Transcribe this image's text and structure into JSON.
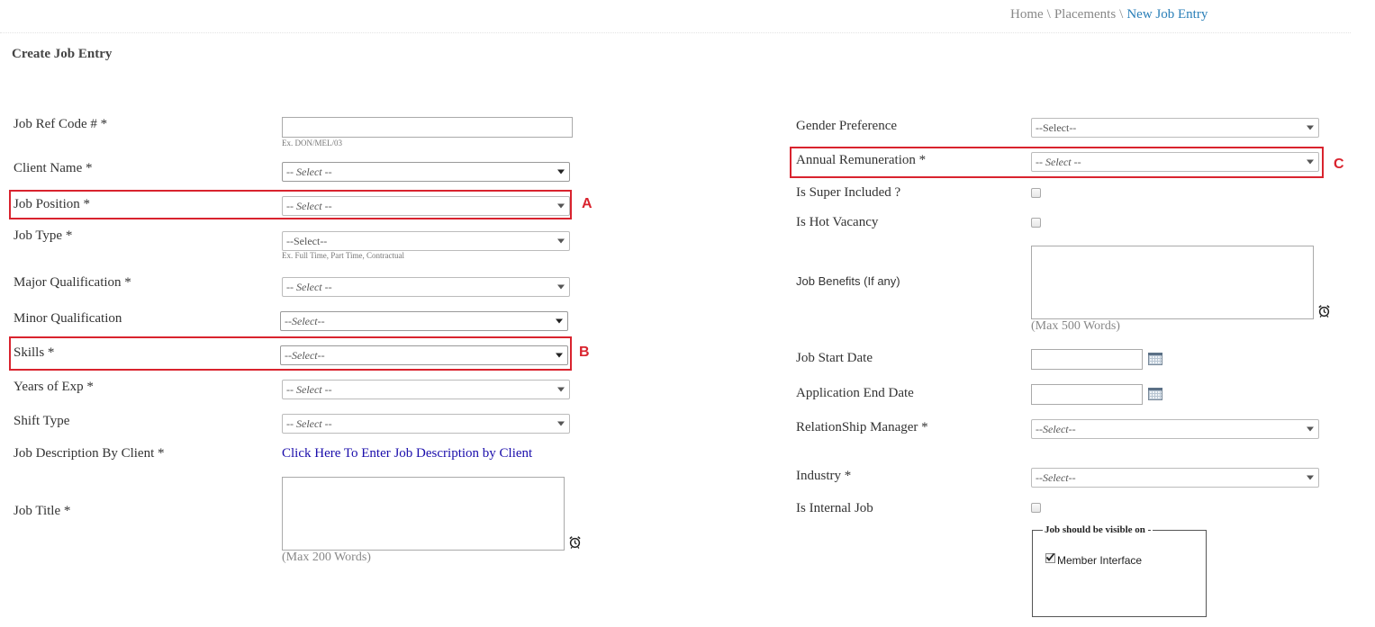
{
  "breadcrumb": {
    "home": "Home",
    "placements": "Placements",
    "current": "New Job Entry",
    "separator": "\\"
  },
  "page_title": "Create Job Entry",
  "left": {
    "job_ref_code": {
      "label": "Job Ref Code # *",
      "value": "",
      "hint": "Ex. DON/MEL/03"
    },
    "client_name": {
      "label": "Client Name *",
      "selected": "-- Select --"
    },
    "job_position": {
      "label": "Job Position *",
      "selected": "-- Select --",
      "marker": "A"
    },
    "job_type": {
      "label": "Job Type *",
      "selected": "--Select--",
      "hint": "Ex. Full Time, Part Time, Contractual"
    },
    "major_qualification": {
      "label": "Major Qualification *",
      "selected": "-- Select --"
    },
    "minor_qualification": {
      "label": "Minor Qualification",
      "selected": "--Select--"
    },
    "skills": {
      "label": "Skills *",
      "selected": "--Select--",
      "marker": "B"
    },
    "years_of_exp": {
      "label": "Years of Exp *",
      "selected": "-- Select --"
    },
    "shift_type": {
      "label": "Shift Type",
      "selected": "-- Select --"
    },
    "job_description": {
      "label": "Job Description By Client *",
      "link": "Click Here To Enter Job Description by Client"
    },
    "job_title": {
      "label": "Job Title *",
      "value": "",
      "max": "(Max 200 Words)"
    }
  },
  "right": {
    "gender_preference": {
      "label": "Gender Preference",
      "selected": "--Select--"
    },
    "annual_remuneration": {
      "label": "Annual Remuneration *",
      "selected": "-- Select --",
      "marker": "C"
    },
    "is_super_included": {
      "label": "Is Super Included ?",
      "checked": false
    },
    "is_hot_vacancy": {
      "label": "Is Hot Vacancy",
      "checked": false
    },
    "job_benefits": {
      "label": "Job Benefits (If any)",
      "value": "",
      "max": "(Max 500 Words)"
    },
    "job_start_date": {
      "label": "Job Start Date",
      "value": ""
    },
    "application_end_date": {
      "label": "Application End Date",
      "value": ""
    },
    "relationship_manager": {
      "label": "RelationShip Manager *",
      "selected": "--Select--"
    },
    "industry": {
      "label": "Industry *",
      "selected": "--Select--"
    },
    "is_internal_job": {
      "label": "Is Internal Job",
      "checked": false
    },
    "visibility": {
      "legend": "Job should be visible on -",
      "option_label": "Member Interface",
      "checked": true
    }
  },
  "icons": {
    "alarm": "alarm-clock-icon",
    "calendar": "calendar-icon",
    "dropdown": "chevron-down-icon",
    "checkmark": "checkmark-icon"
  },
  "colors": {
    "highlight": "#d9232e",
    "link": "#1a0dab",
    "breadcrumb_current": "#2a7fb8"
  }
}
